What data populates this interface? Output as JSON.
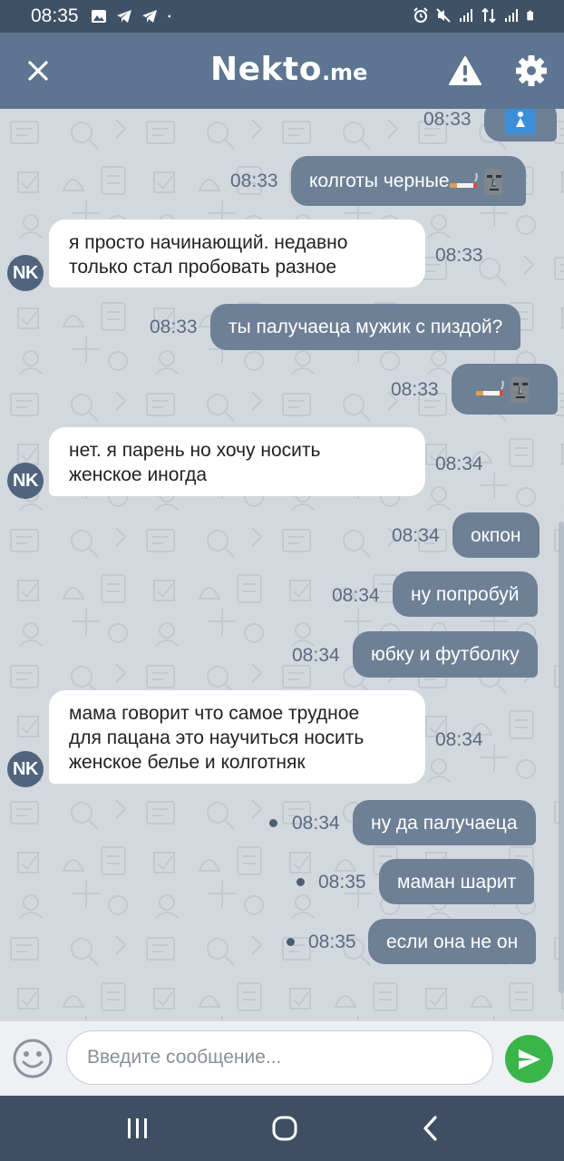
{
  "status_bar": {
    "time": "08:35",
    "left_icons": [
      "image-icon",
      "telegram-icon",
      "telegram-icon",
      "dot-icon"
    ],
    "right_icons": [
      "alarm-icon",
      "mute-icon",
      "signal-icon",
      "data-icon",
      "signal-icon",
      "battery-icon"
    ]
  },
  "header": {
    "logo_main": "Nekto",
    "logo_sub": ".me",
    "close_icon": "close-icon",
    "report_icon": "warning-icon",
    "settings_icon": "gear-icon"
  },
  "colors": {
    "header_bg": "#5d7590",
    "status_bg": "#3f5166",
    "outgoing_bubble": "#6e8096",
    "incoming_bubble": "#ffffff",
    "send_button": "#3ab54a",
    "chat_bg": "#d3d8de"
  },
  "messages": [
    {
      "dir": "out",
      "time": "08:33",
      "text": "",
      "emoji": "restroom-icon"
    },
    {
      "dir": "out",
      "time": "08:33",
      "text": "колготы черные",
      "emoji": "cigarette-moai-icon"
    },
    {
      "dir": "in",
      "time": "08:33",
      "avatar": "NK",
      "text": "я просто начинающий. недавно\nтолько стал пробовать разное"
    },
    {
      "dir": "out",
      "time": "08:33",
      "text": "ты палучаеца мужик с пиздой?"
    },
    {
      "dir": "out",
      "time": "08:33",
      "text": "",
      "emoji": "cigarette-moai-icon"
    },
    {
      "dir": "in",
      "time": "08:34",
      "avatar": "NK",
      "text": "нет. я парень но хочу носить\nженское иногда"
    },
    {
      "dir": "out",
      "time": "08:34",
      "text": "окпон"
    },
    {
      "dir": "out",
      "time": "08:34",
      "text": "ну попробуй"
    },
    {
      "dir": "out",
      "time": "08:34",
      "text": "юбку и футболку"
    },
    {
      "dir": "in",
      "time": "08:34",
      "avatar": "NK",
      "text": "мама говорит что самое трудное\nдля пацана это научиться носить\nженское белье и колготняк"
    },
    {
      "dir": "out",
      "time": "08:34",
      "text": "ну да палучаеца",
      "unread_dot": true
    },
    {
      "dir": "out",
      "time": "08:35",
      "text": "маман шарит",
      "unread_dot": true
    },
    {
      "dir": "out",
      "time": "08:35",
      "text": "если она не он",
      "unread_dot": true
    }
  ],
  "input": {
    "placeholder": "Введите сообщение...",
    "value": "",
    "emoji_icon": "smile-icon",
    "send_icon": "send-icon"
  },
  "nav_bar": {
    "buttons": [
      "recent-apps-icon",
      "home-icon",
      "back-icon"
    ]
  }
}
